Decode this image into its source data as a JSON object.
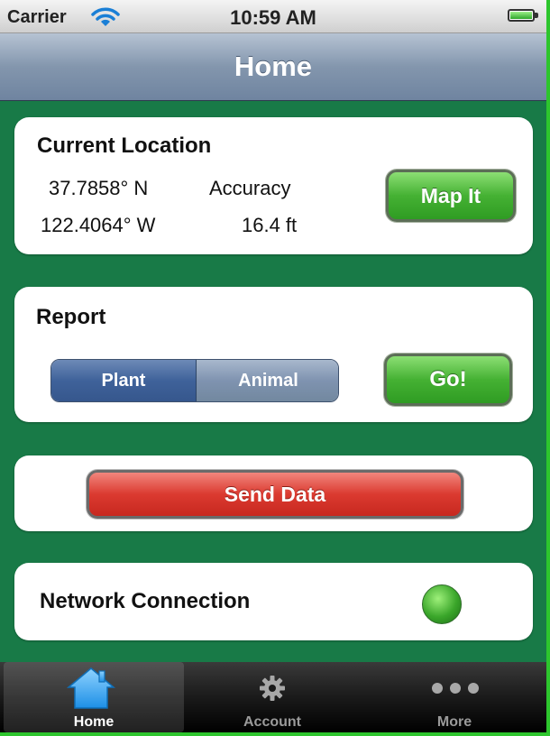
{
  "status_bar": {
    "carrier": "Carrier",
    "time": "10:59 AM"
  },
  "nav": {
    "title": "Home"
  },
  "current_location": {
    "title": "Current Location",
    "latitude": "37.7858° N",
    "longitude": "122.4064° W",
    "accuracy_label": "Accuracy",
    "accuracy_value": "16.4 ft",
    "map_button": "Map It"
  },
  "report": {
    "title": "Report",
    "segments": [
      "Plant",
      "Animal"
    ],
    "selected_segment": "Plant",
    "go_button": "Go!"
  },
  "send": {
    "button": "Send Data"
  },
  "network": {
    "label": "Network Connection",
    "status_color": "#3aa62a"
  },
  "tabs": [
    {
      "label": "Home",
      "icon": "house-icon",
      "selected": true
    },
    {
      "label": "Account",
      "icon": "gear-icon",
      "selected": false
    },
    {
      "label": "More",
      "icon": "more-dots-icon",
      "selected": false
    }
  ],
  "colors": {
    "background": "#187a47",
    "frame": "#2dc52d",
    "accent_green": "#45b133",
    "accent_red": "#db3a30"
  }
}
